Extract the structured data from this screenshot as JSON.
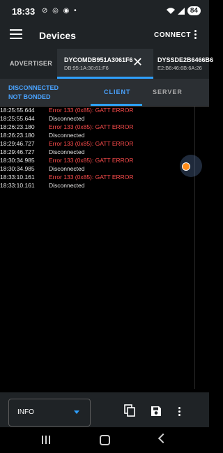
{
  "status_bar": {
    "time": "18:33",
    "notif_icons": "⊘ ◎ ◉ •",
    "battery": "84"
  },
  "app_bar": {
    "title": "Devices",
    "connect_label": "CONNECT"
  },
  "device_tabs": {
    "advertiser_label": "ADVERTISER",
    "active": {
      "name": "DYCOMDB951A3061F6",
      "address": "DB:95:1A:30:61:F6"
    },
    "other": {
      "name": "DYSSDE2B6466B6",
      "address": "E2:B6:46:6B:6A:26"
    }
  },
  "connection": {
    "state": "DISCONNECTED",
    "bond": "NOT BONDED",
    "tab_client": "CLIENT",
    "tab_server": "SERVER"
  },
  "log": [
    {
      "ts": "18:25:55.644",
      "msg": "Error 133 (0x85): GATT ERROR",
      "error": true
    },
    {
      "ts": "18:25:55.644",
      "msg": "Disconnected",
      "error": false
    },
    {
      "ts": "18:26:23.180",
      "msg": "Error 133 (0x85): GATT ERROR",
      "error": true
    },
    {
      "ts": "18:26:23.180",
      "msg": "Disconnected",
      "error": false
    },
    {
      "ts": "18:29:46.727",
      "msg": "Error 133 (0x85): GATT ERROR",
      "error": true
    },
    {
      "ts": "18:29:46.727",
      "msg": "Disconnected",
      "error": false
    },
    {
      "ts": "18:30:34.985",
      "msg": "Error 133 (0x85): GATT ERROR",
      "error": true
    },
    {
      "ts": "18:30:34.985",
      "msg": "Disconnected",
      "error": false
    },
    {
      "ts": "18:33:10.161",
      "msg": "Error 133 (0x85): GATT ERROR",
      "error": true
    },
    {
      "ts": "18:33:10.161",
      "msg": "Disconnected",
      "error": false
    }
  ],
  "toolbar": {
    "log_level": "INFO",
    "icons": [
      "copy-icon",
      "save-icon",
      "more-vert-icon"
    ]
  },
  "colors": {
    "accent": "#2ea0ff",
    "error": "#ff4d4d",
    "surface": "#1f2326",
    "scroll_thumb": "#ff8c1a"
  }
}
